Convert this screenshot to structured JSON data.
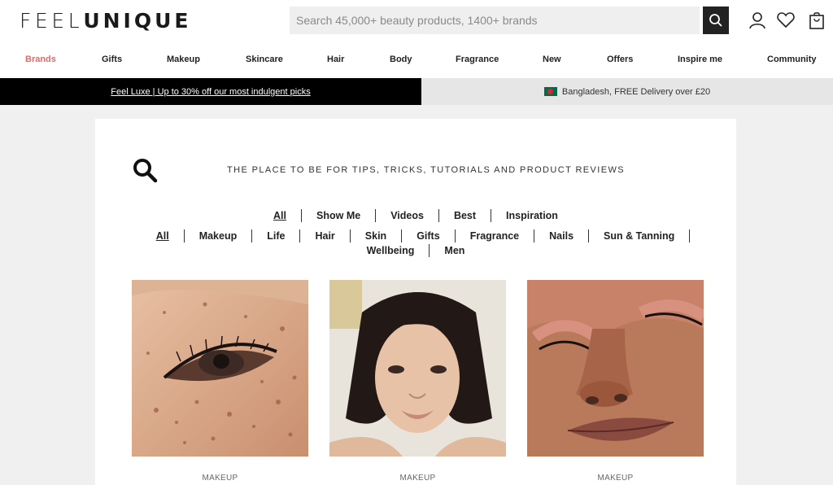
{
  "header": {
    "logo_light": "FEEL",
    "logo_bold": "UNIQUE",
    "search_placeholder": "Search 45,000+ beauty products, 1400+ brands",
    "icons": [
      "search-icon",
      "account-icon",
      "heart-icon",
      "bag-icon"
    ]
  },
  "nav": {
    "items": [
      "Brands",
      "Gifts",
      "Makeup",
      "Skincare",
      "Hair",
      "Body",
      "Fragrance",
      "New",
      "Offers",
      "Inspire me",
      "Community"
    ],
    "active_color": "#e06a6a"
  },
  "promo": {
    "left_text": "Feel Luxe | Up to 30% off our most indulgent picks",
    "right_text": "Bangladesh, FREE Delivery over £20"
  },
  "content": {
    "tagline": "THE PLACE TO BE FOR TIPS, TRICKS, TUTORIALS AND PRODUCT REVIEWS",
    "filters_primary": [
      "All",
      "Show Me",
      "Videos",
      "Best",
      "Inspiration"
    ],
    "filters_secondary_row1": [
      "All",
      "Makeup",
      "Life",
      "Hair",
      "Skin",
      "Gifts",
      "Fragrance",
      "Nails",
      "Sun & Tanning"
    ],
    "filters_secondary_row2": [
      "Wellbeing",
      "Men"
    ],
    "articles": [
      {
        "category": "MAKEUP"
      },
      {
        "category": "MAKEUP"
      },
      {
        "category": "MAKEUP"
      }
    ]
  }
}
